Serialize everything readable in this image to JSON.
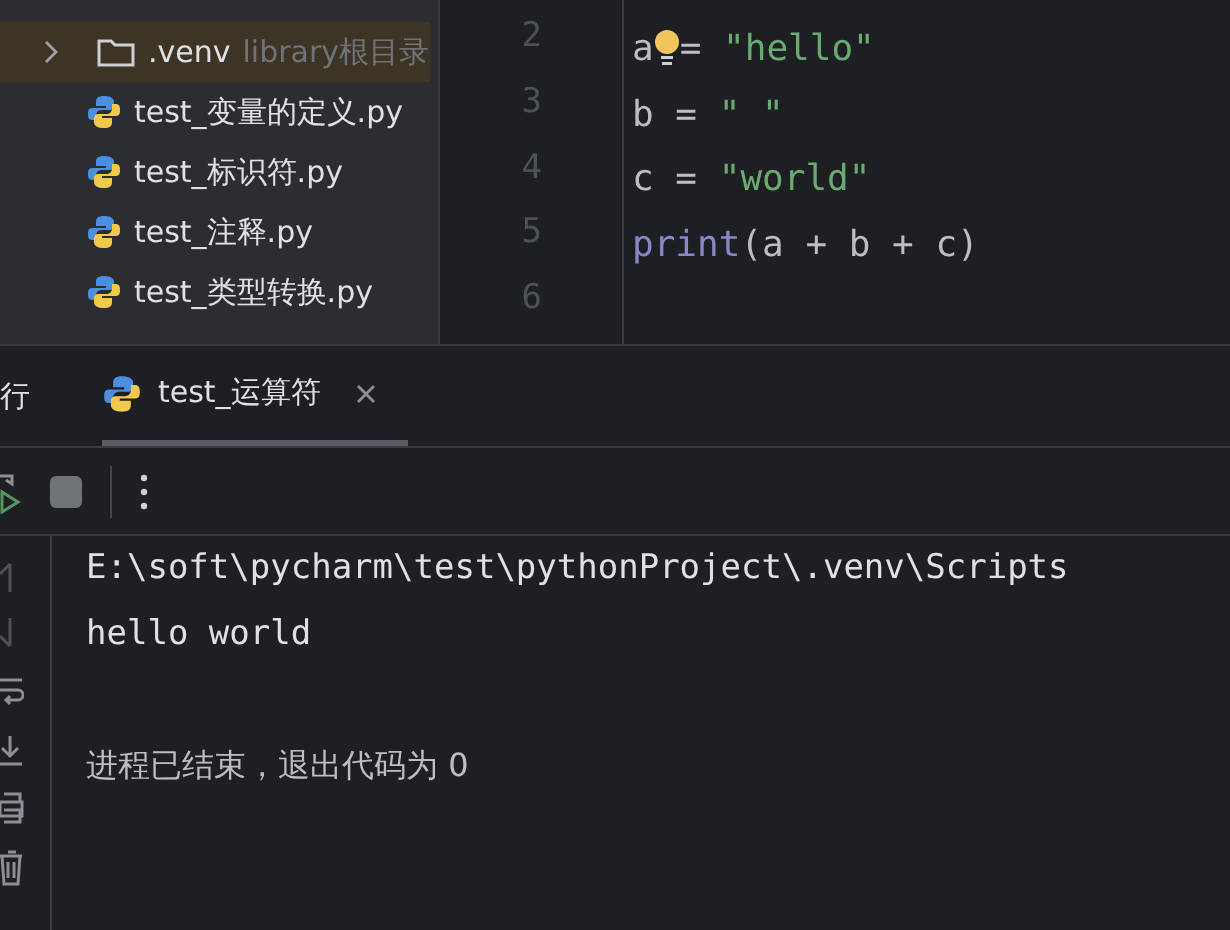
{
  "project_tree": {
    "items": [
      {
        "name": ".venv",
        "note": "library根目录",
        "kind": "folder",
        "selected": true,
        "expanded": false
      },
      {
        "name": "test_变量的定义.py",
        "kind": "python",
        "selected": false
      },
      {
        "name": "test_标识符.py",
        "kind": "python",
        "selected": false
      },
      {
        "name": "test_注释.py",
        "kind": "python",
        "selected": false
      },
      {
        "name": "test_类型转换.py",
        "kind": "python",
        "selected": false
      }
    ]
  },
  "editor": {
    "lines": [
      {
        "number": "2",
        "tokens": [
          {
            "kind": "plain",
            "text": "a"
          },
          {
            "kind": "bulb"
          },
          {
            "kind": "plain",
            "text": "= "
          },
          {
            "kind": "string",
            "text": "\"hello\""
          }
        ]
      },
      {
        "number": "3",
        "tokens": [
          {
            "kind": "plain",
            "text": "b = "
          },
          {
            "kind": "string",
            "text": "\" \""
          }
        ]
      },
      {
        "number": "4",
        "tokens": [
          {
            "kind": "plain",
            "text": "c = "
          },
          {
            "kind": "string",
            "text": "\"world\""
          }
        ]
      },
      {
        "number": "5",
        "tokens": [
          {
            "kind": "builtin",
            "text": "print"
          },
          {
            "kind": "plain",
            "text": "(a + b + c)"
          }
        ]
      },
      {
        "number": "6"
      }
    ]
  },
  "run_panel": {
    "title": "行",
    "tabs": [
      {
        "label": "test_运算符",
        "selected": true
      }
    ],
    "toolbar": [
      {
        "kind": "rerun"
      },
      {
        "kind": "stop"
      },
      {
        "kind": "divider"
      },
      {
        "kind": "more"
      }
    ],
    "side_tools": [
      {
        "kind": "up"
      },
      {
        "kind": "down"
      },
      {
        "kind": "wrap"
      },
      {
        "kind": "scroll-end"
      },
      {
        "kind": "print"
      },
      {
        "kind": "trash"
      }
    ],
    "console": [
      {
        "kind": "command",
        "text": "E:\\soft\\pycharm\\test\\pythonProject\\.venv\\Scripts"
      },
      {
        "kind": "output",
        "text": "hello world"
      },
      {
        "kind": "status",
        "text": "进程已结束，退出代码为 0"
      }
    ]
  }
}
